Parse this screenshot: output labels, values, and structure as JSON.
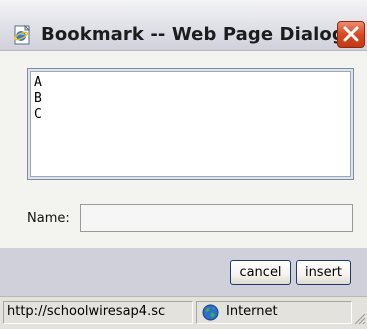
{
  "window": {
    "title": "Bookmark -- Web Page Dialog",
    "app_icon": "ie-page-icon",
    "close_icon": "close-icon"
  },
  "bookmarks": {
    "items": [
      "A",
      "B",
      "C"
    ]
  },
  "name_field": {
    "label": "Name:",
    "value": ""
  },
  "buttons": {
    "cancel_label": "cancel",
    "insert_label": "insert"
  },
  "status_bar": {
    "url": "http://schoolwiresap4.sc",
    "zone_label": "Internet",
    "zone_icon": "globe-icon"
  },
  "colors": {
    "close_button": "#d8481f",
    "button_border": "#1f3a73",
    "chrome": "#cfd0da"
  }
}
